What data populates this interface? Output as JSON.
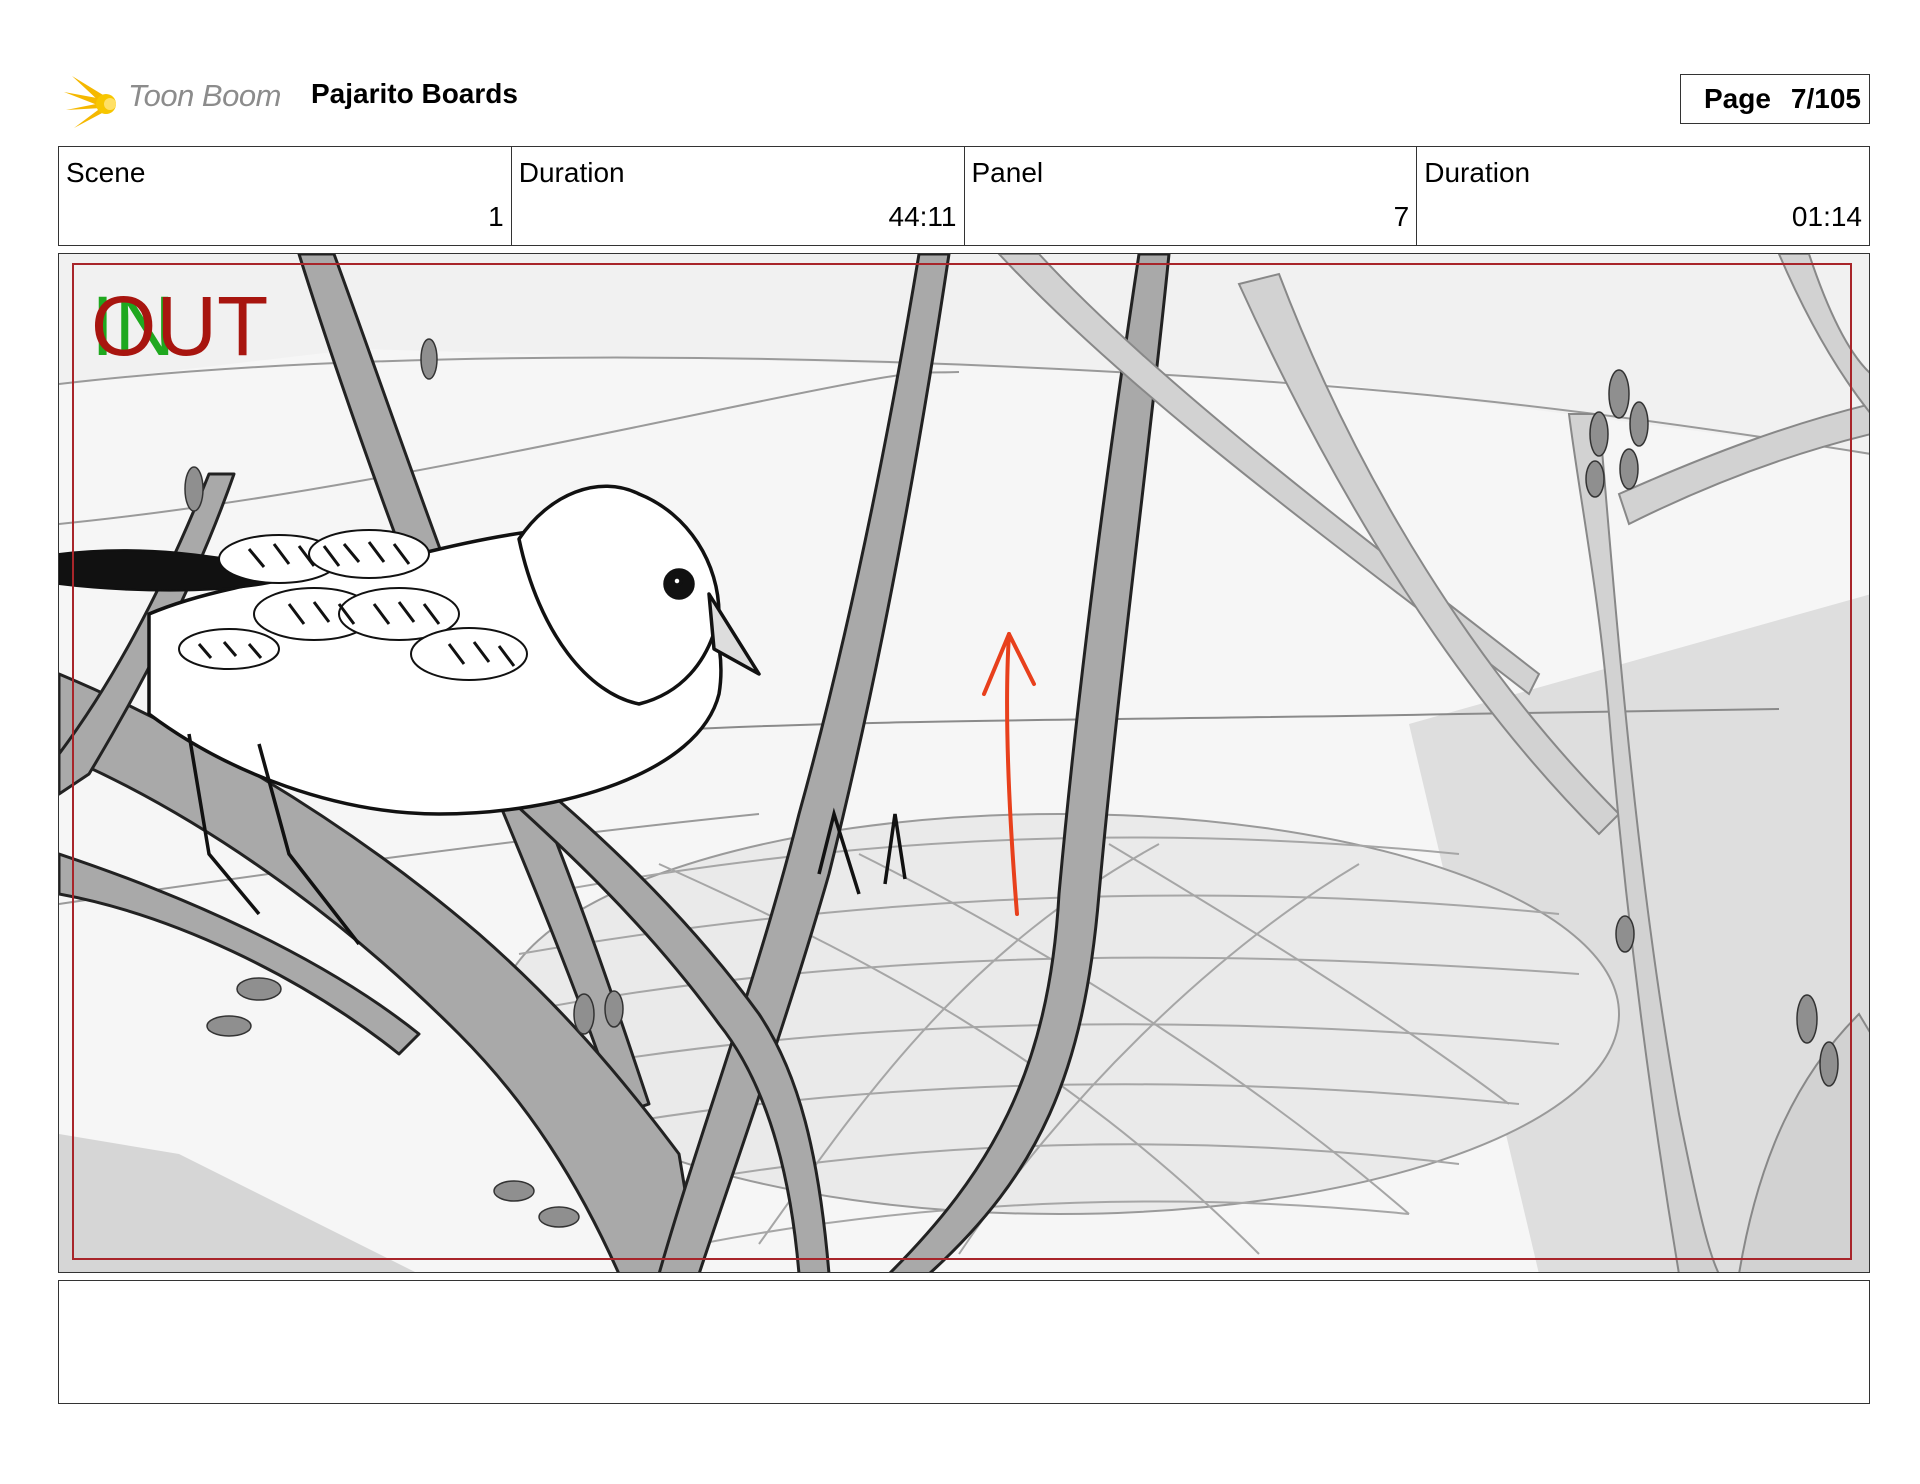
{
  "header": {
    "brand": "Toon Boom",
    "project_title": "Pajarito Boards",
    "page_label": "Page",
    "page_value": "7/105"
  },
  "info": {
    "scene_label": "Scene",
    "scene_value": "1",
    "scene_duration_label": "Duration",
    "scene_duration_value": "44:11",
    "panel_label": "Panel",
    "panel_value": "7",
    "panel_duration_label": "Duration",
    "panel_duration_value": "01:14"
  },
  "panel": {
    "in_marker": "IN",
    "out_marker": "OUT",
    "safe_frame_color": "#a8252a",
    "arrow_color": "#e8401c"
  },
  "notes": {
    "text": ""
  }
}
